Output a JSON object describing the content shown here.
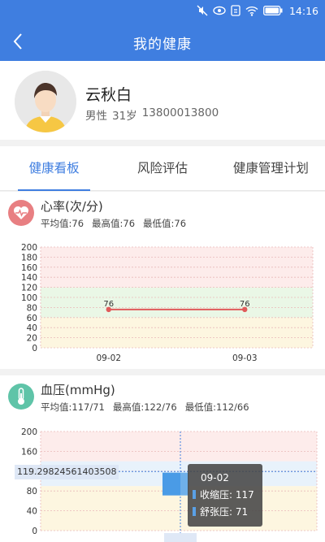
{
  "status": {
    "time": "14:16"
  },
  "header": {
    "title": "我的健康"
  },
  "profile": {
    "name": "云秋白",
    "gender": "男性",
    "age": "31岁",
    "phone": "13800013800"
  },
  "tabs": [
    {
      "label": "健康看板",
      "active": true
    },
    {
      "label": "风险评估",
      "active": false
    },
    {
      "label": "健康管理计划",
      "active": false
    }
  ],
  "heart": {
    "title": "心率(次/分)",
    "stats": {
      "avg": "平均值:76",
      "max": "最高值:76",
      "min": "最低值:76"
    },
    "icon": "heartbeat-icon",
    "icon_color": "#e87f82"
  },
  "bp": {
    "title": "血压(mmHg)",
    "stats": {
      "avg": "平均值:117/71",
      "max": "最高值:122/76",
      "min": "最低值:112/66"
    },
    "icon": "thermometer-icon",
    "icon_color": "#5fc4a8",
    "hover_value": "119.29824561403508",
    "tooltip": {
      "date": "09-02",
      "systolic": "收缩压: 117",
      "diastolic": "舒张压: 71"
    }
  },
  "colors": {
    "primary": "#3f7ee0",
    "high_band": "#fdeceb",
    "normal_band": "#eaf7e6",
    "low_band": "#fdf6e0",
    "line": "#e05a5a",
    "bar": "#4a9be6"
  },
  "chart_data": [
    {
      "type": "line",
      "title": "心率(次/分)",
      "categories": [
        "09-02",
        "09-03"
      ],
      "series": [
        {
          "values": [
            76,
            76
          ]
        }
      ],
      "data_labels": [
        "76",
        "76"
      ],
      "ylim": [
        0,
        200
      ],
      "yticks": [
        0,
        20,
        40,
        60,
        80,
        100,
        120,
        140,
        160,
        180,
        200
      ],
      "bands": [
        {
          "from": 0,
          "to": 60,
          "color": "#fdf6e0"
        },
        {
          "from": 60,
          "to": 120,
          "color": "#eaf7e6"
        },
        {
          "from": 120,
          "to": 200,
          "color": "#fdeceb"
        }
      ],
      "grid": true
    },
    {
      "type": "bar",
      "title": "血压(mmHg)",
      "categories": [
        "09-02"
      ],
      "series": [
        {
          "values": [
            117
          ]
        },
        {
          "values": [
            71
          ]
        }
      ],
      "ylim": [
        0,
        200
      ],
      "yticks": [
        0,
        40,
        80,
        120,
        160,
        200
      ],
      "bands": [
        {
          "from": 0,
          "to": 90,
          "color": "#fdf6e0"
        },
        {
          "from": 90,
          "to": 140,
          "color": "#e8f2fb"
        },
        {
          "from": 140,
          "to": 200,
          "color": "#fdeceb"
        }
      ],
      "grid": true
    }
  ]
}
